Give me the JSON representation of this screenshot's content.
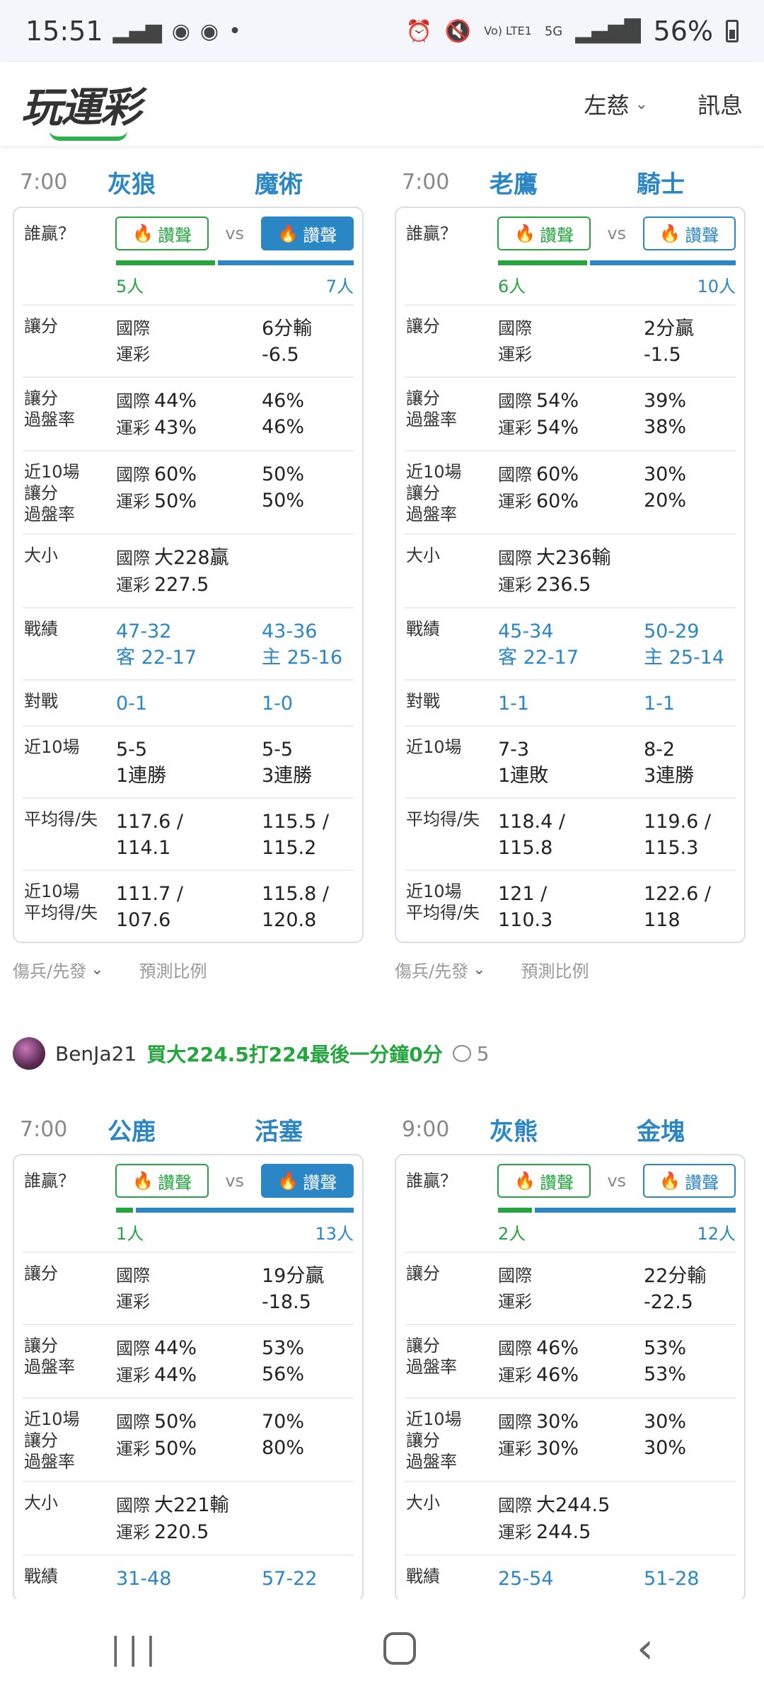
{
  "status": {
    "time": "15:51",
    "battery": "56%",
    "network": "5G",
    "volte": "Vo) LTE1"
  },
  "app": {
    "logo": "玩運彩",
    "user": "左慈",
    "messages": "訊息"
  },
  "labels": {
    "who_wins": "誰贏？",
    "cheer": "讚聲",
    "vs": "vs",
    "spread": "讓分",
    "spread_rate_1": "讓分",
    "spread_rate_2": "過盤率",
    "last10_1": "近10場",
    "last10_2": "讓分",
    "last10_3": "過盤率",
    "total": "大小",
    "record": "戰績",
    "h2h": "對戰",
    "last10": "近10場",
    "avg": "平均得/失",
    "last10avg_1": "近10場",
    "last10avg_2": "平均得/失",
    "intl": "國際",
    "yuncai": "運彩",
    "injury": "傷兵/先發",
    "predict": "預測比例"
  },
  "games": [
    {
      "time": "7:00",
      "team_a": "灰狼",
      "team_b": "魔術",
      "cheer_a": "5人",
      "cheer_b": "7人",
      "spread_b_1": "6分輸",
      "spread_b_2": "-6.5",
      "rate_a_1": "44%",
      "rate_a_2": "43%",
      "rate_b_1": "46%",
      "rate_b_2": "46%",
      "l10_a_1": "60%",
      "l10_a_2": "50%",
      "l10_b_1": "50%",
      "l10_b_2": "50%",
      "total_1": "大228贏",
      "total_2": "227.5",
      "rec_a_1": "47-32",
      "rec_a_2": "客 22-17",
      "rec_b_1": "43-36",
      "rec_b_2": "主 25-16",
      "h2h_a": "0-1",
      "h2h_b": "1-0",
      "last_a_1": "5-5",
      "last_a_2": "1連勝",
      "last_b_1": "5-5",
      "last_b_2": "3連勝",
      "avg_a_1": "117.6 /",
      "avg_a_2": "114.1",
      "avg_b_1": "115.5 /",
      "avg_b_2": "115.2",
      "l10avg_a_1": "111.7 /",
      "l10avg_a_2": "107.6",
      "l10avg_b_1": "115.8 /",
      "l10avg_b_2": "120.8"
    },
    {
      "time": "7:00",
      "team_a": "老鷹",
      "team_b": "騎士",
      "cheer_a": "6人",
      "cheer_b": "10人",
      "spread_b_1": "2分贏",
      "spread_b_2": "-1.5",
      "rate_a_1": "54%",
      "rate_a_2": "54%",
      "rate_b_1": "39%",
      "rate_b_2": "38%",
      "l10_a_1": "60%",
      "l10_a_2": "60%",
      "l10_b_1": "30%",
      "l10_b_2": "20%",
      "total_1": "大236輸",
      "total_2": "236.5",
      "rec_a_1": "45-34",
      "rec_a_2": "客 22-17",
      "rec_b_1": "50-29",
      "rec_b_2": "主 25-14",
      "h2h_a": "1-1",
      "h2h_b": "1-1",
      "last_a_1": "7-3",
      "last_a_2": "1連敗",
      "last_b_1": "8-2",
      "last_b_2": "3連勝",
      "avg_a_1": "118.4 /",
      "avg_a_2": "115.8",
      "avg_b_1": "119.6 /",
      "avg_b_2": "115.3",
      "l10avg_a_1": "121 /",
      "l10avg_a_2": "110.3",
      "l10avg_b_1": "122.6 /",
      "l10avg_b_2": "118"
    },
    {
      "time": "7:00",
      "team_a": "公鹿",
      "team_b": "活塞",
      "cheer_a": "1人",
      "cheer_b": "13人",
      "spread_b_1": "19分贏",
      "spread_b_2": "-18.5",
      "rate_a_1": "44%",
      "rate_a_2": "44%",
      "rate_b_1": "53%",
      "rate_b_2": "56%",
      "l10_a_1": "50%",
      "l10_a_2": "50%",
      "l10_b_1": "70%",
      "l10_b_2": "80%",
      "total_1": "大221輸",
      "total_2": "220.5",
      "rec_a_1": "31-48",
      "rec_b_1": "57-22"
    },
    {
      "time": "9:00",
      "team_a": "灰熊",
      "team_b": "金塊",
      "cheer_a": "2人",
      "cheer_b": "12人",
      "spread_b_1": "22分輸",
      "spread_b_2": "-22.5",
      "rate_a_1": "46%",
      "rate_a_2": "46%",
      "rate_b_1": "53%",
      "rate_b_2": "53%",
      "l10_a_1": "30%",
      "l10_a_2": "30%",
      "l10_b_1": "30%",
      "l10_b_2": "30%",
      "total_1": "大244.5",
      "total_2": "244.5",
      "rec_a_1": "25-54",
      "rec_b_1": "51-28"
    }
  ],
  "comment": {
    "user": "BenJa21",
    "text": "買大224.5打224最後一分鐘0分",
    "count": "5"
  },
  "colors": {
    "green": "#24a53d",
    "blue": "#2b86c5"
  }
}
